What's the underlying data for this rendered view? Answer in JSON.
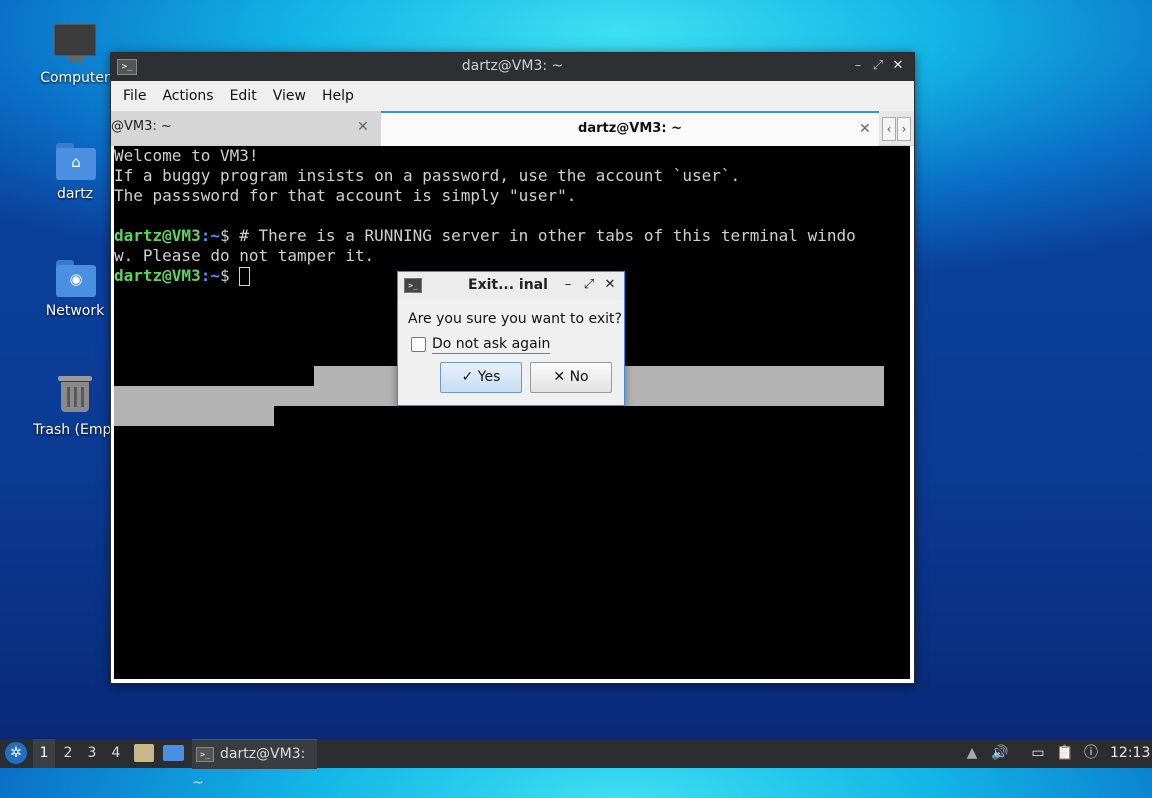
{
  "desktop": {
    "icons": [
      {
        "label": "Computer"
      },
      {
        "label": "dartz"
      },
      {
        "label": "Network"
      },
      {
        "label": "Trash (Empt"
      }
    ]
  },
  "window": {
    "title": "dartz@VM3: ~",
    "menu": [
      "File",
      "Actions",
      "Edit",
      "View",
      "Help"
    ],
    "tabs": [
      {
        "label": "@VM3: ~",
        "active": false
      },
      {
        "label": "dartz@VM3: ~",
        "active": true
      }
    ],
    "terminal": {
      "line1": "Welcome to VM3!",
      "line2": "If a buggy program insists on a password, use the account `user`.",
      "line3": "The passsword for that account is simply \"user\".",
      "prompt_user": "dartz@VM3",
      "prompt_path": ":~",
      "prompt_sign": "$ ",
      "command": "# There is a RUNNING server in other tabs of this terminal windo",
      "command_wrap": "w. Please do not tamper it."
    }
  },
  "dialog": {
    "title": "Exit...  inal",
    "message": "Are you sure you want to exit?",
    "checkbox_label": "Do not ask again",
    "checkbox_checked": false,
    "yes_label": "Yes",
    "no_label": "No"
  },
  "taskbar": {
    "workspaces": [
      "1",
      "2",
      "3",
      "4"
    ],
    "active_workspace": "1",
    "task_label": "dartz@VM3: ~",
    "clock": "12:13"
  }
}
